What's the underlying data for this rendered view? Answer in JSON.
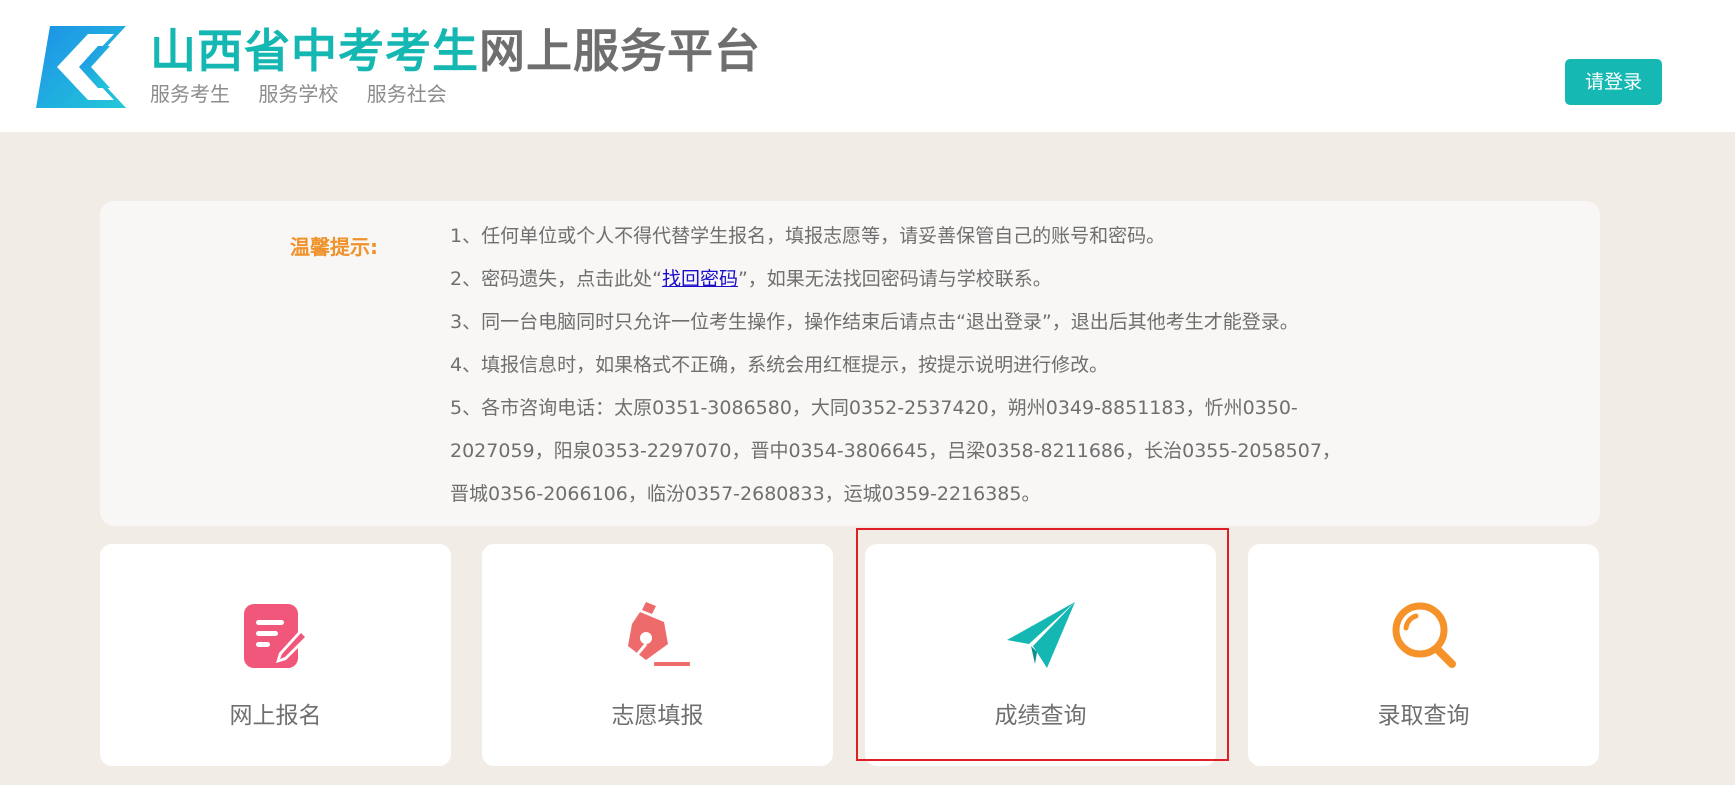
{
  "header": {
    "title_primary": "山西省中考考生",
    "title_secondary": "网上服务平台",
    "subtitle": [
      "服务考生",
      "服务学校",
      "服务社会"
    ],
    "login_label": "请登录"
  },
  "notice": {
    "label": "温馨提示:",
    "item1": "1、任何单位或个人不得代替学生报名，填报志愿等，请妥善保管自己的账号和密码。",
    "item2_prefix": "2、密码遗失，点击此处“",
    "item2_link": "找回密码",
    "item2_suffix": "”，如果无法找回密码请与学校联系。",
    "item3": "3、同一台电脑同时只允许一位考生操作，操作结束后请点击“退出登录”，退出后其他考生才能登录。",
    "item4": "4、填报信息时，如果格式不正确，系统会用红框提示，按提示说明进行修改。",
    "item5": "5、各市咨询电话：太原0351-3086580，大同0352-2537420，朔州0349-8851183，忻州0350-2027059，阳泉0353-2297070，晋中0354-3806645，吕梁0358-8211686，长治0355-2058507，晋城0356-2066106，临汾0357-2680833，运城0359-2216385。"
  },
  "cards": [
    {
      "label": "网上报名",
      "icon": "edit-note-icon",
      "color": "#f0577a"
    },
    {
      "label": "志愿填报",
      "icon": "fountain-pen-icon",
      "color": "#ee6b6b"
    },
    {
      "label": "成绩查询",
      "icon": "paper-plane-icon",
      "color": "#14b7b2"
    },
    {
      "label": "录取查询",
      "icon": "magnifier-icon",
      "color": "#f5922a"
    }
  ],
  "colors": {
    "accent": "#14b7b2",
    "notice_label": "#f0922b",
    "highlight_border": "#e01e25",
    "page_background": "#f2ece6"
  }
}
